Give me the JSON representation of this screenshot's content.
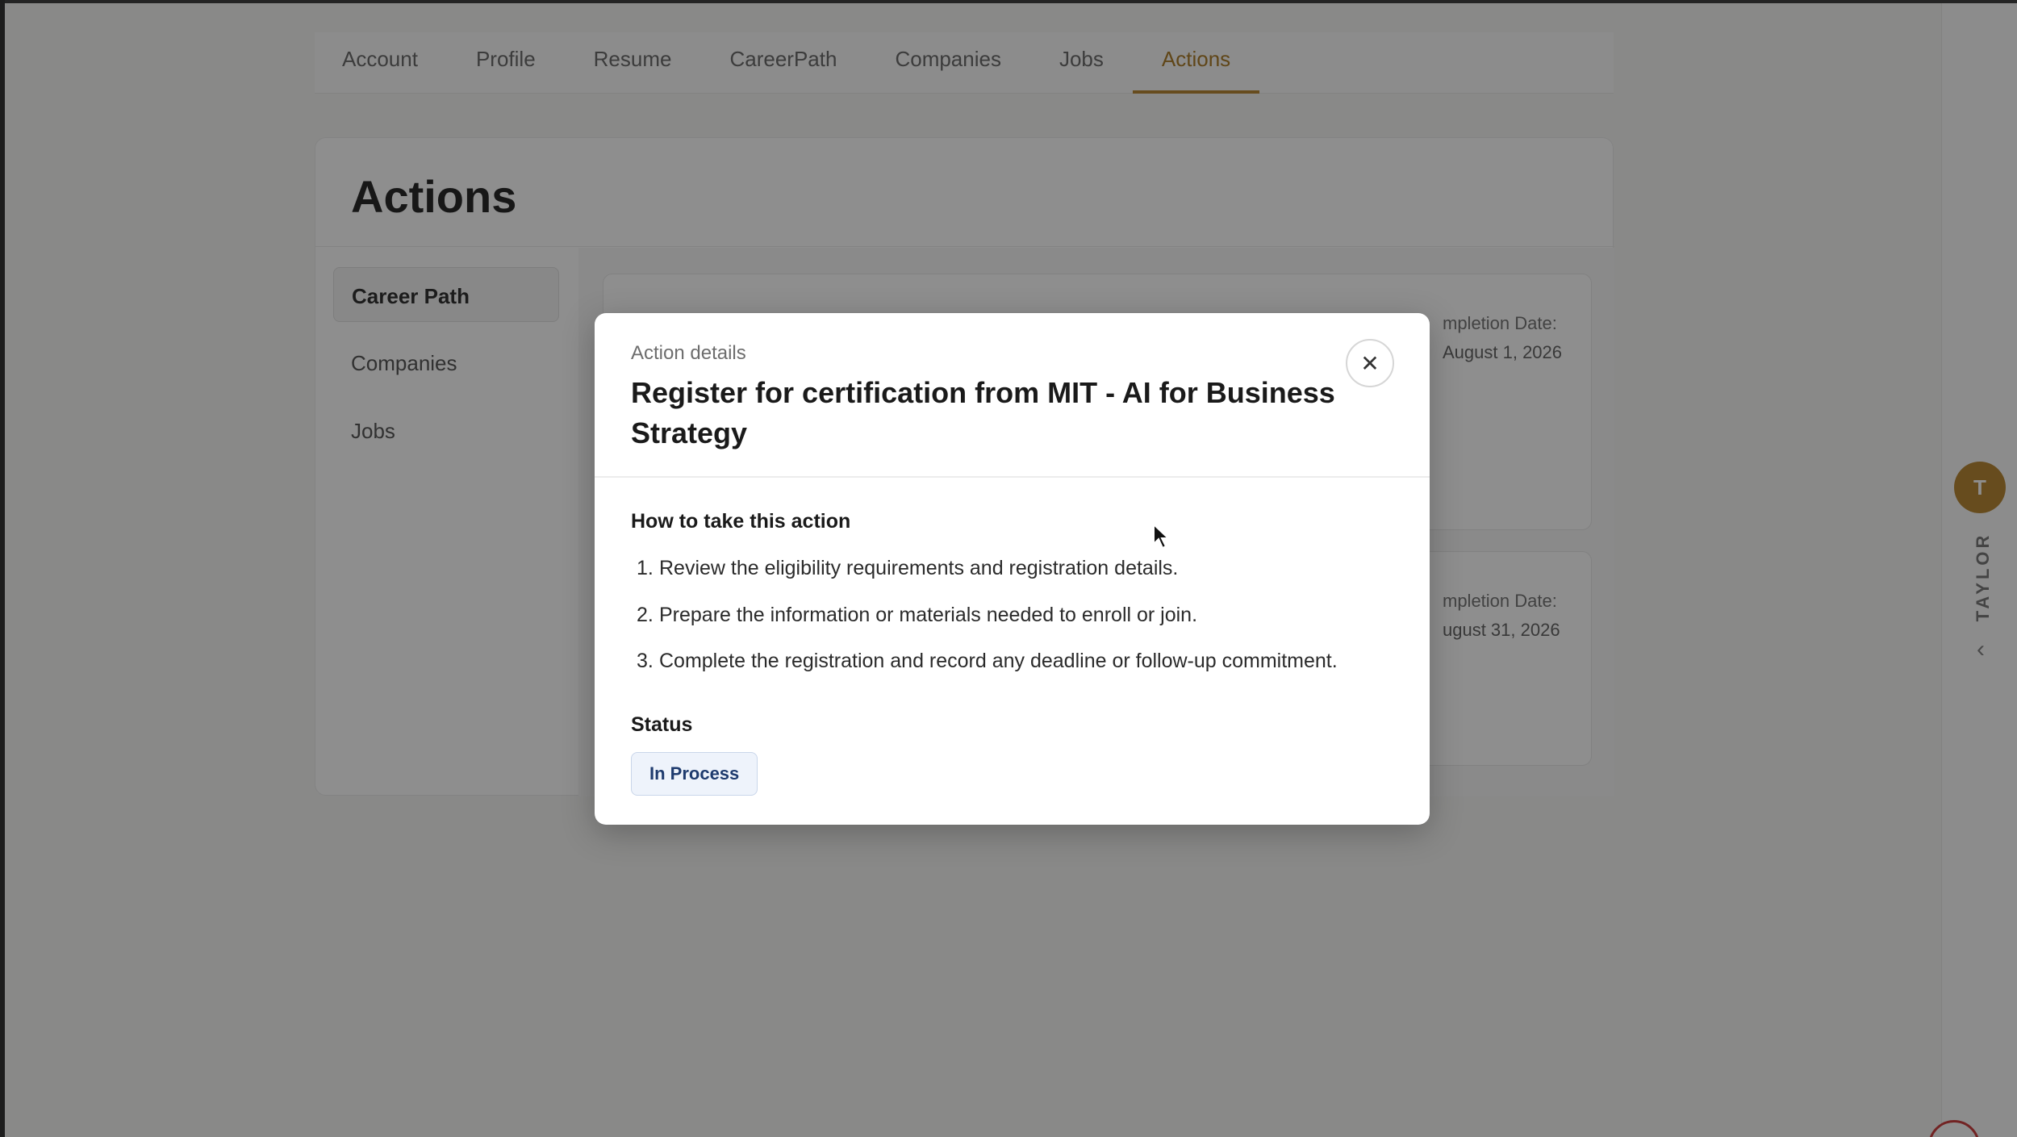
{
  "nav": {
    "tabs": [
      {
        "label": "Account"
      },
      {
        "label": "Profile"
      },
      {
        "label": "Resume"
      },
      {
        "label": "CareerPath"
      },
      {
        "label": "Companies"
      },
      {
        "label": "Jobs"
      },
      {
        "label": "Actions",
        "active": true
      }
    ]
  },
  "page": {
    "title": "Actions",
    "side_menu": [
      {
        "label": "Career Path",
        "active": true
      },
      {
        "label": "Companies"
      },
      {
        "label": "Jobs"
      }
    ],
    "action_cards": [
      {
        "date_label": "mpletion Date:",
        "date_value": "August 1, 2026"
      },
      {
        "date_label": "mpletion Date:",
        "date_value": "ugust 31, 2026"
      }
    ]
  },
  "user": {
    "initial": "T",
    "name": "TAYLOR"
  },
  "modal": {
    "eyebrow": "Action details",
    "title": "Register for certification from MIT - AI for Business Strategy",
    "close_glyph": "✕",
    "how_heading": "How to take this action",
    "steps": [
      {
        "num": "1.",
        "text": "Review the eligibility requirements and registration details."
      },
      {
        "num": "2.",
        "text": "Prepare the information or materials needed to enroll or join."
      },
      {
        "num": "3.",
        "text": "Complete the registration and record any deadline or follow-up commitment."
      }
    ],
    "status_heading": "Status",
    "status_value": "In Process"
  },
  "colors": {
    "accent": "#b07a1e",
    "status_text": "#1e3b6e",
    "status_bg": "#eef3fb"
  }
}
